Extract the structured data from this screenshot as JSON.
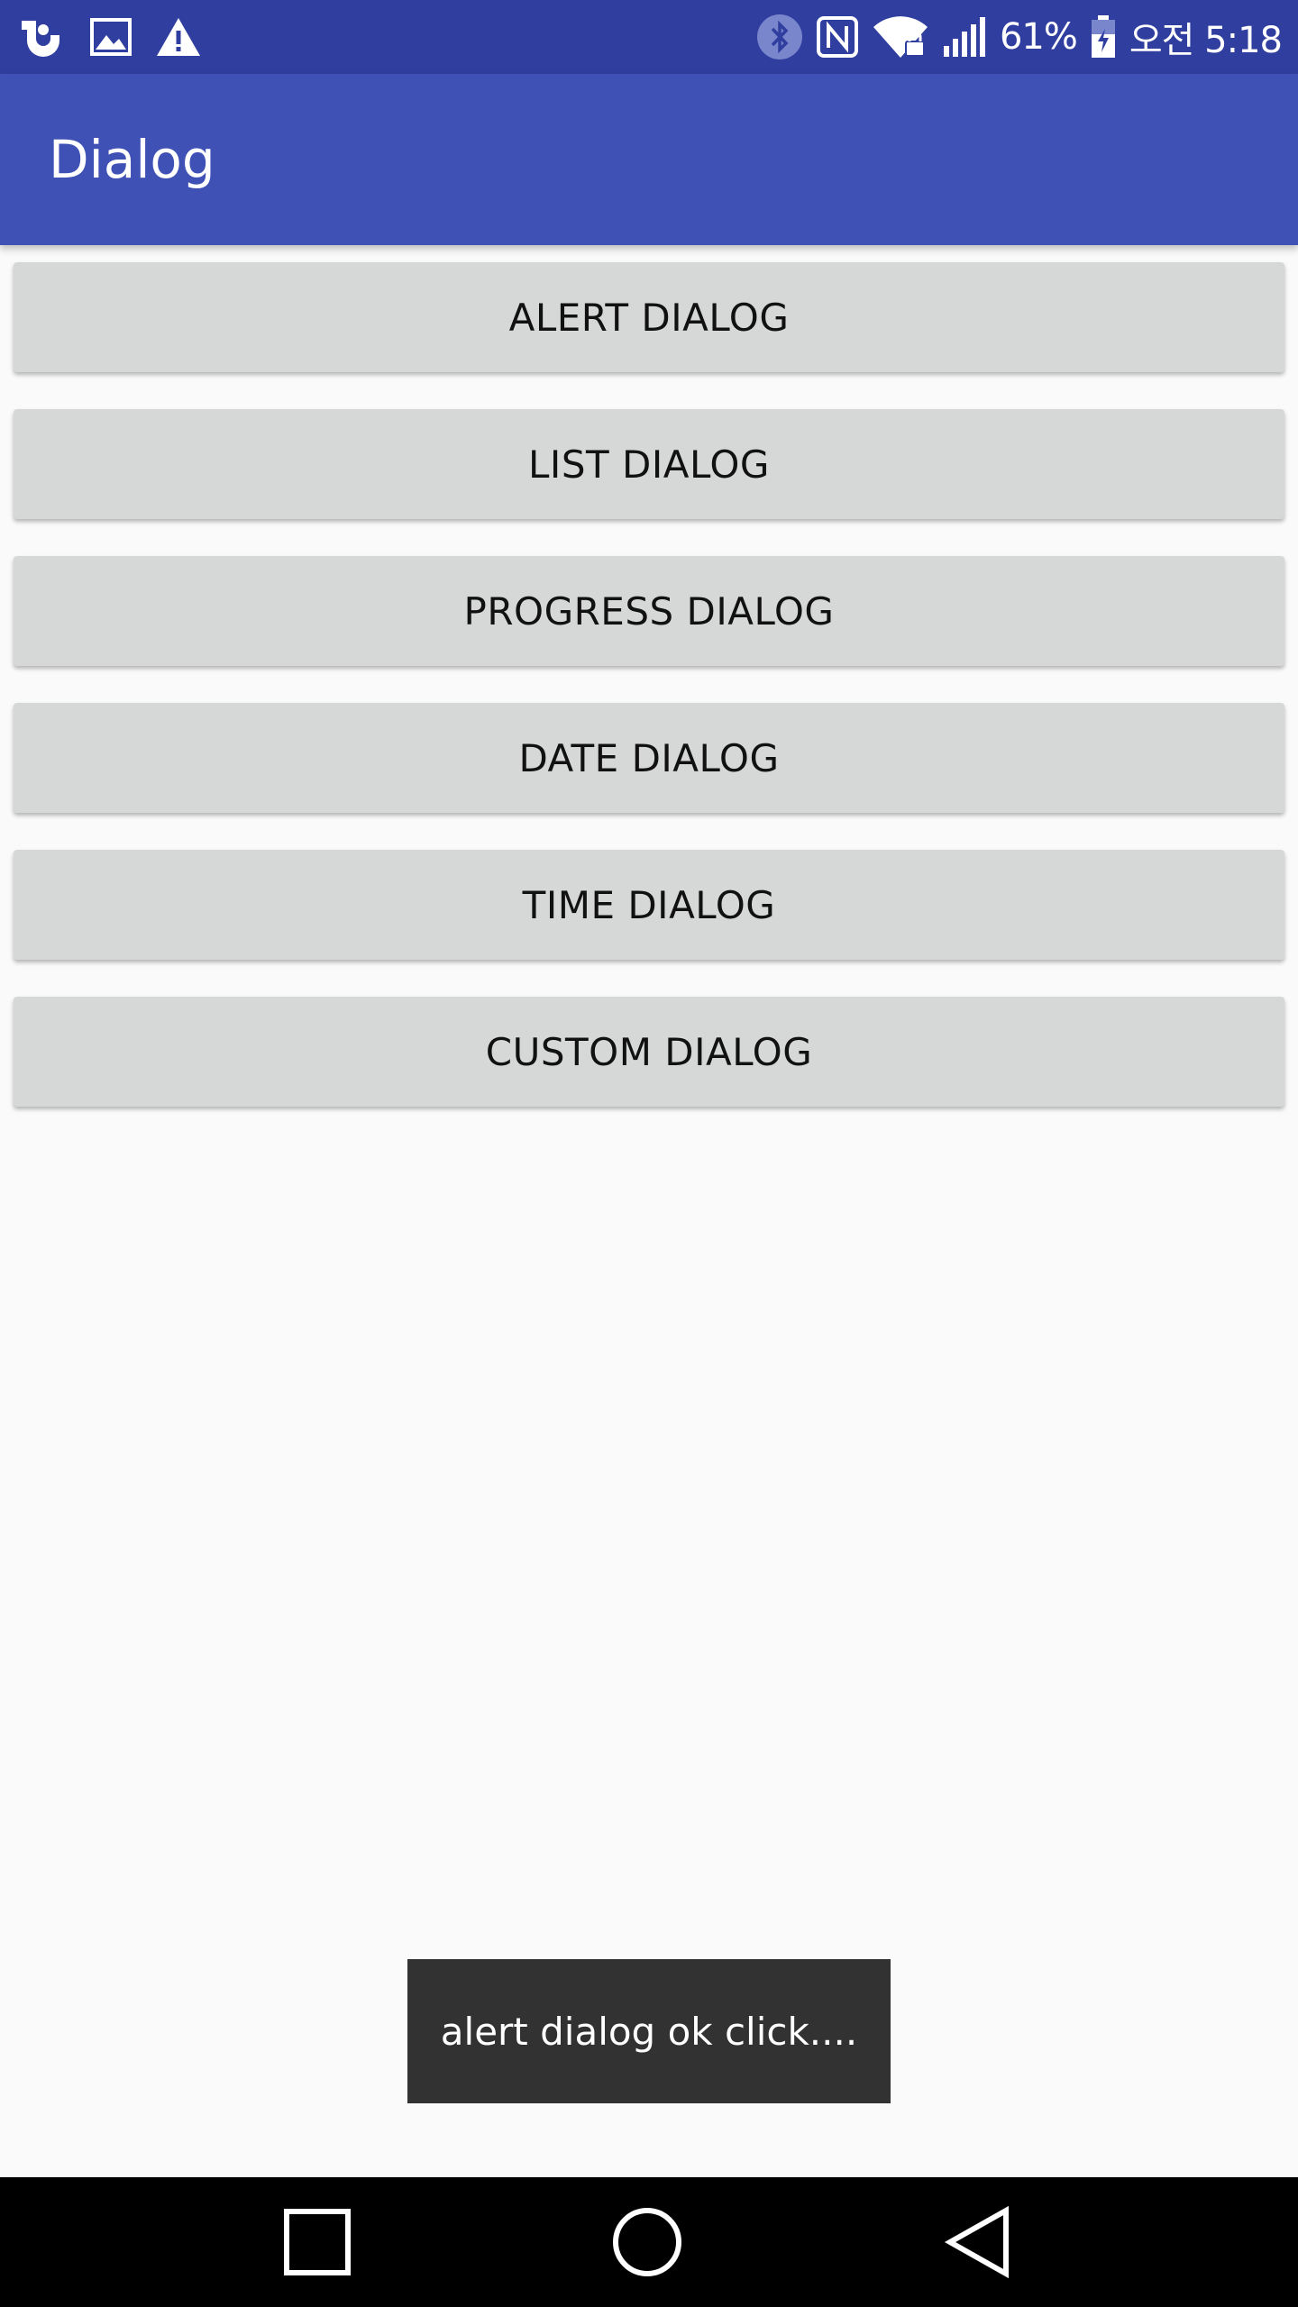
{
  "status_bar": {
    "left_icons": [
      "u-plus-icon",
      "image-icon",
      "warning-icon"
    ],
    "right_icons": [
      "bluetooth-icon",
      "nfc-icon",
      "wifi-icon",
      "signal-icon",
      "battery-charging-icon"
    ],
    "battery": "61%",
    "time": "오전 5:18"
  },
  "app_bar": {
    "title": "Dialog"
  },
  "buttons": {
    "alert": "ALERT DIALOG",
    "list": "LIST DIALOG",
    "progress": "PROGRESS DIALOG",
    "date": "DATE DIALOG",
    "time": "TIME DIALOG",
    "custom": "CUSTOM DIALOG"
  },
  "toast": {
    "message": "alert dialog ok click...."
  },
  "nav_bar": {
    "icons": [
      "recent-apps-icon",
      "home-icon",
      "back-icon"
    ]
  },
  "colors": {
    "status_bar": "#303f9f",
    "app_bar": "#3f51b5",
    "background": "#fafafa",
    "button": "#d6d7d7",
    "toast": "#323232",
    "nav_bar": "#000000"
  }
}
